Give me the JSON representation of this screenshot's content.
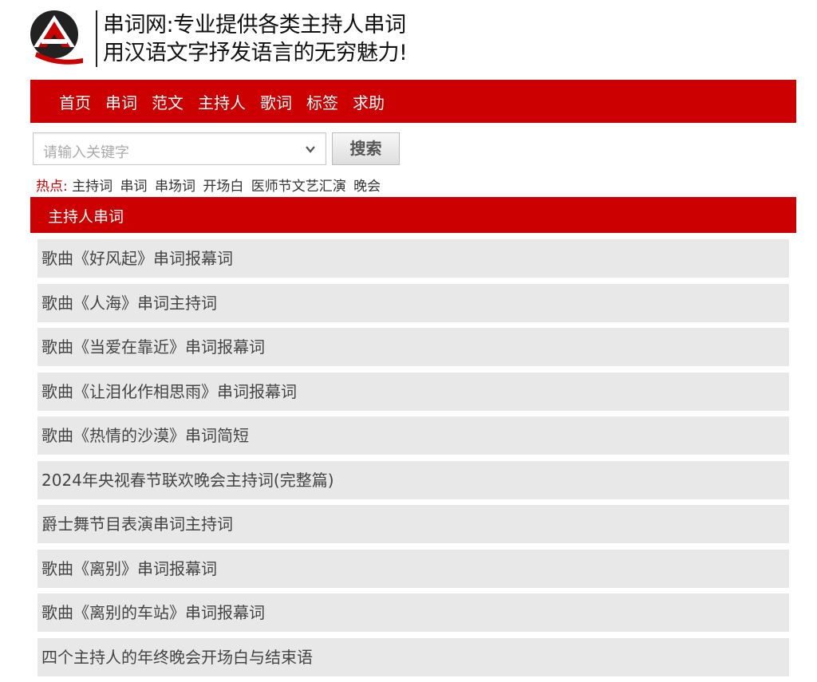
{
  "header": {
    "slogan_line1": "串词网:专业提供各类主持人串词",
    "slogan_line2": "用汉语文字抒发语言的无穷魅力!"
  },
  "nav": {
    "items": [
      "首页",
      "串词",
      "范文",
      "主持人",
      "歌词",
      "标签",
      "求助"
    ]
  },
  "search": {
    "placeholder": "请输入关键字",
    "button_label": "搜索"
  },
  "hot": {
    "label": "热点:",
    "keywords": [
      "主持词",
      "串词",
      "串场词",
      "开场白",
      "医师节文艺汇演",
      "晚会"
    ]
  },
  "section": {
    "title": "主持人串词"
  },
  "articles": [
    "歌曲《好风起》串词报幕词",
    "歌曲《人海》串词主持词",
    "歌曲《当爱在靠近》串词报幕词",
    "歌曲《让泪化作相思雨》串词报幕词",
    "歌曲《热情的沙漠》串词简短",
    "2024年央视春节联欢晚会主持词(完整篇)",
    "爵士舞节目表演串词主持词",
    "歌曲《离别》串词报幕词",
    "歌曲《离别的车站》串词报幕词",
    "四个主持人的年终晚会开场白与结束语"
  ],
  "colors": {
    "brand_red": "#cc0000",
    "list_bg": "#e8e8e8"
  }
}
